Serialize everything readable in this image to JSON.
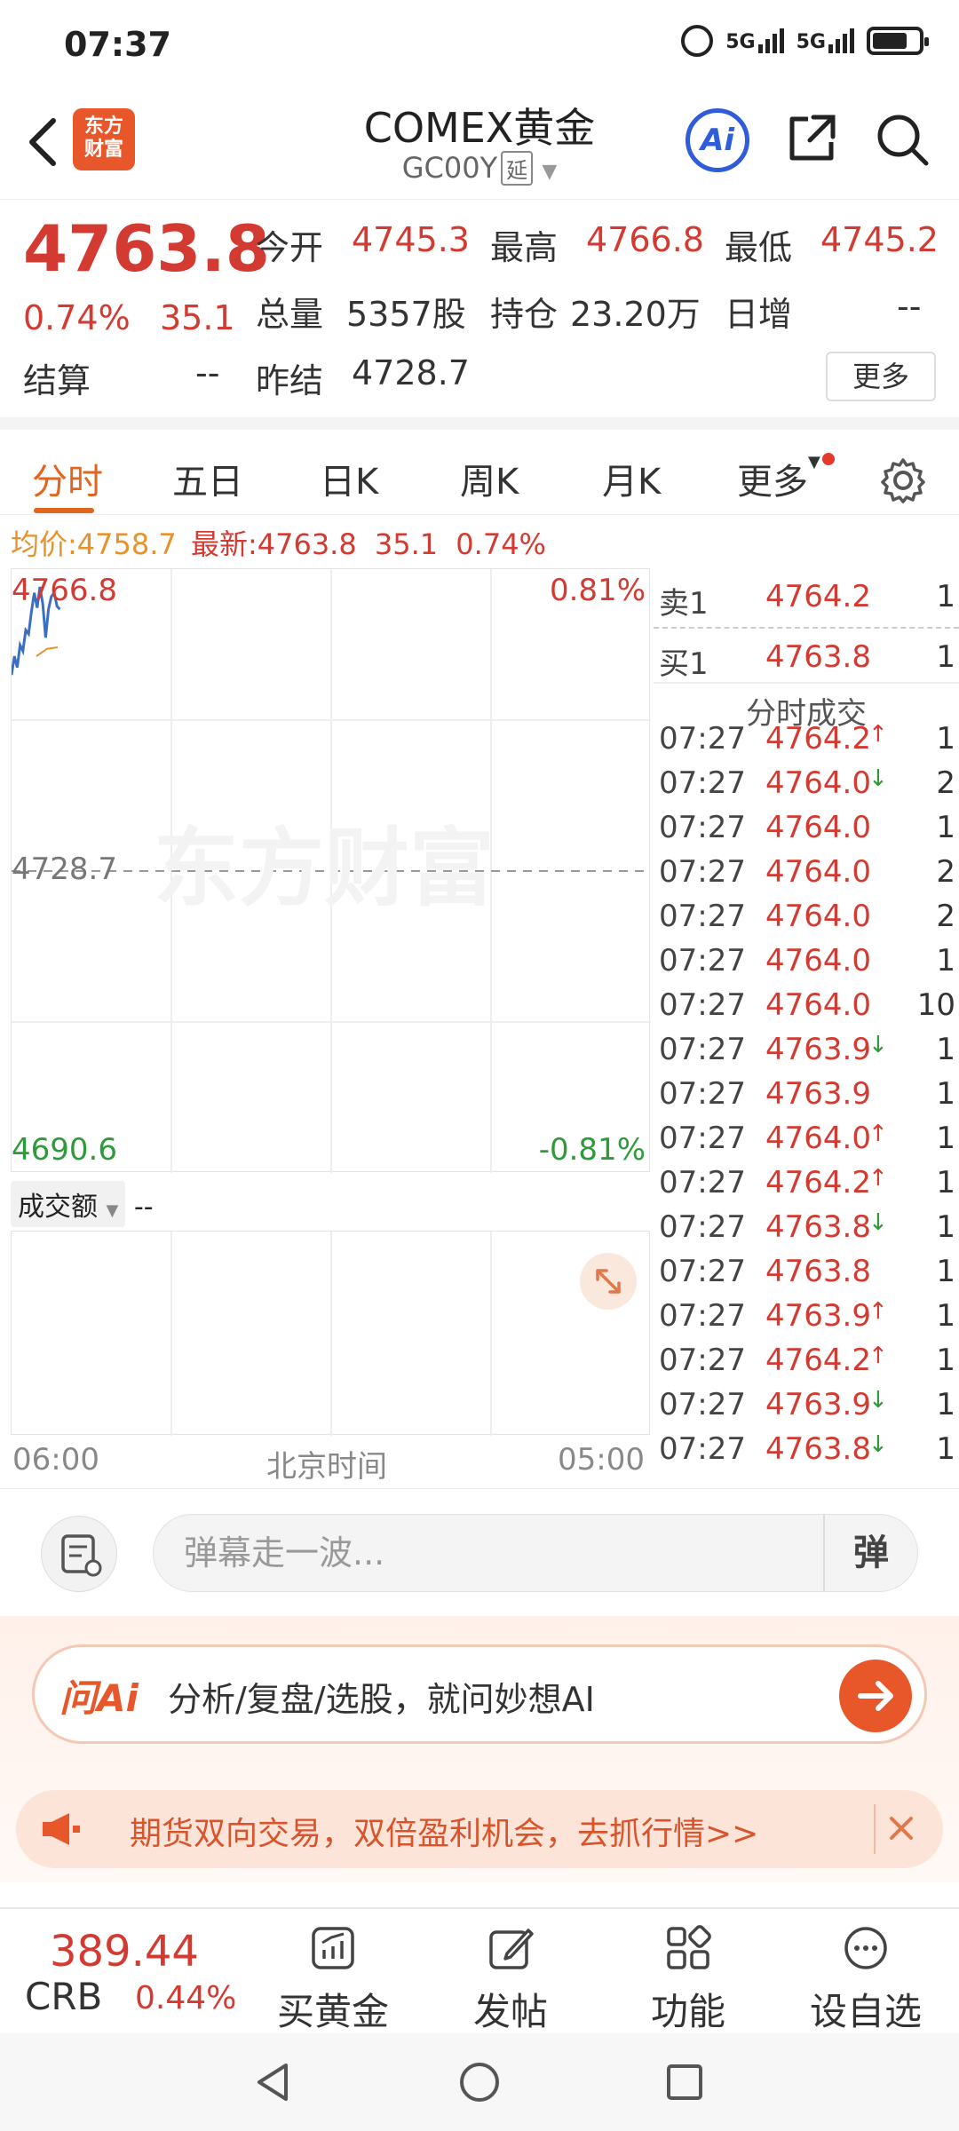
{
  "status_bar": {
    "time": "07:37",
    "network1": "5G",
    "network2": "5G"
  },
  "header": {
    "logo_text": "东方\n财富",
    "title": "COMEX黄金",
    "subtitle": "GC00Y",
    "delay_tag": "延",
    "ai_label": "Ai"
  },
  "quote": {
    "price": "4763.8",
    "change_pct": "0.74%",
    "change_abs": "35.1",
    "settle_label": "结算",
    "settle_value": "--",
    "prev_settle_label": "昨结",
    "prev_settle_value": "4728.7",
    "open_label": "今开",
    "open_value": "4745.3",
    "high_label": "最高",
    "high_value": "4766.8",
    "low_label": "最低",
    "low_value": "4745.2",
    "volume_label": "总量",
    "volume_value": "5357股",
    "position_label": "持仓",
    "position_value": "23.20万",
    "daily_inc_label": "日增",
    "daily_inc_value": "--",
    "more_label": "更多"
  },
  "tabs": [
    {
      "label": "分时"
    },
    {
      "label": "五日"
    },
    {
      "label": "日K"
    },
    {
      "label": "周K"
    },
    {
      "label": "月K"
    },
    {
      "label": "更多"
    }
  ],
  "avg_line": {
    "avg_label": "均价:",
    "avg_value": "4758.7",
    "latest_label": "最新:",
    "latest_value": "4763.8",
    "latest_chg": "35.1",
    "latest_pct": "0.74%"
  },
  "chart": {
    "y_top": "4766.8",
    "y_mid": "4728.7",
    "y_bottom": "4690.6",
    "pct_top": "0.81%",
    "pct_bottom": "-0.81%",
    "watermark": "东方财富",
    "volume_selector": "成交额",
    "volume_value": "--",
    "x_start": "06:00",
    "x_mid": "北京时间",
    "x_end": "05:00"
  },
  "chart_data": {
    "type": "line",
    "title": "",
    "xlabel": "北京时间",
    "ylabel": "",
    "ylim": [
      4690.6,
      4766.8
    ],
    "x_range": [
      "06:00",
      "05:00"
    ],
    "reference_line": 4728.7,
    "series": [
      {
        "values": [
          4755.0,
          4757.5,
          4756.0,
          4759.0,
          4758.2,
          4761.0,
          4760.5,
          4763.5,
          4766.0,
          4764.0,
          4766.8,
          4764.5,
          4760.0,
          4763.8,
          4765.5,
          4766.0,
          4764.2,
          4763.8
        ]
      }
    ]
  },
  "order_book": {
    "ask_label": "卖1",
    "ask_price": "4764.2",
    "ask_qty": "1",
    "bid_label": "买1",
    "bid_price": "4763.8",
    "bid_qty": "1",
    "trades_title": "分时成交",
    "trades": [
      {
        "time": "07:27",
        "price": "4764.2",
        "dir": "↑",
        "qty": "1"
      },
      {
        "time": "07:27",
        "price": "4764.0",
        "dir": "↓",
        "qty": "2"
      },
      {
        "time": "07:27",
        "price": "4764.0",
        "dir": "",
        "qty": "1"
      },
      {
        "time": "07:27",
        "price": "4764.0",
        "dir": "",
        "qty": "2"
      },
      {
        "time": "07:27",
        "price": "4764.0",
        "dir": "",
        "qty": "2"
      },
      {
        "time": "07:27",
        "price": "4764.0",
        "dir": "",
        "qty": "1"
      },
      {
        "time": "07:27",
        "price": "4764.0",
        "dir": "",
        "qty": "10"
      },
      {
        "time": "07:27",
        "price": "4763.9",
        "dir": "↓",
        "qty": "1"
      },
      {
        "time": "07:27",
        "price": "4763.9",
        "dir": "",
        "qty": "1"
      },
      {
        "time": "07:27",
        "price": "4764.0",
        "dir": "↑",
        "qty": "1"
      },
      {
        "time": "07:27",
        "price": "4764.2",
        "dir": "↑",
        "qty": "1"
      },
      {
        "time": "07:27",
        "price": "4763.8",
        "dir": "↓",
        "qty": "1"
      },
      {
        "time": "07:27",
        "price": "4763.8",
        "dir": "",
        "qty": "1"
      },
      {
        "time": "07:27",
        "price": "4763.9",
        "dir": "↑",
        "qty": "1"
      },
      {
        "time": "07:27",
        "price": "4764.2",
        "dir": "↑",
        "qty": "1"
      },
      {
        "time": "07:27",
        "price": "4763.9",
        "dir": "↓",
        "qty": "1"
      },
      {
        "time": "07:27",
        "price": "4763.8",
        "dir": "↓",
        "qty": "1"
      }
    ]
  },
  "danmu": {
    "placeholder": "弹幕走一波...",
    "toggle_label": "弹"
  },
  "ai_panel": {
    "brand": "问Ai",
    "prompt": "分析/复盘/选股，就问妙想AI",
    "promo_text": "期货双向交易，双倍盈利机会，去抓行情>>"
  },
  "bottom_bar": {
    "index_value": "389.44",
    "index_name": "CRB",
    "index_change": "0.44%",
    "items": [
      {
        "label": "买黄金"
      },
      {
        "label": "发帖"
      },
      {
        "label": "功能"
      },
      {
        "label": "设自选"
      }
    ]
  },
  "colors": {
    "up": "#d33a31",
    "down": "#2e9a3a",
    "accent": "#e2651f",
    "line": "#3a6fc4",
    "avg": "#e6922d"
  }
}
